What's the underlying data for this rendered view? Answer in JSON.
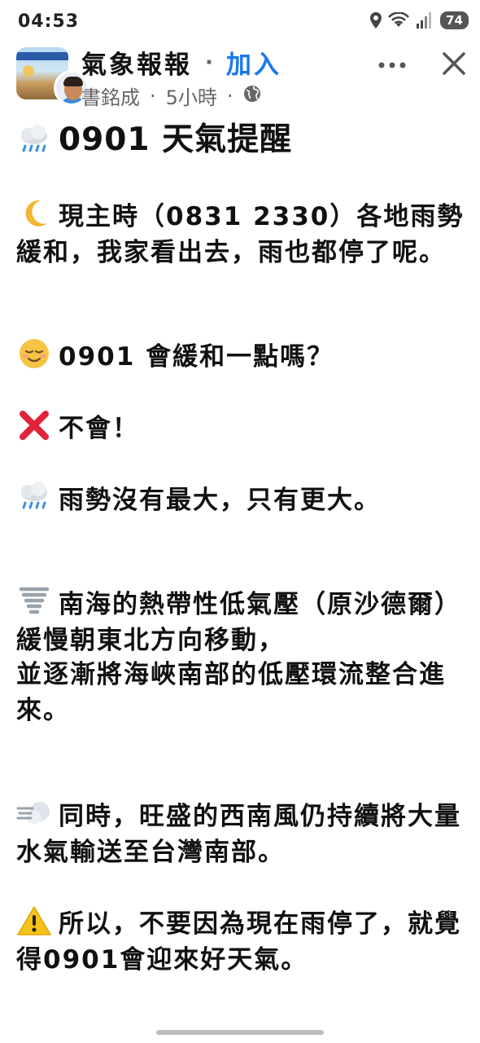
{
  "status_bar": {
    "time": "04:53",
    "battery": "74",
    "icons": [
      "location-icon",
      "wifi-icon",
      "signal-icon",
      "battery-icon"
    ]
  },
  "post": {
    "group_name": "氣象報報",
    "separator": "·",
    "join_label": "加入",
    "author": "書銘成",
    "time_ago": "5小時",
    "privacy_icon": "globe-icon",
    "title": "0901 天氣提醒",
    "paragraphs": [
      {
        "icon": "cloud-rain-icon",
        "text": ""
      },
      {
        "icon": "crescent-moon-icon",
        "text": "現主時（0831 2330）各地雨勢緩和，我家看出去，雨也都停了呢。"
      },
      {
        "icon": "relieved-face-icon",
        "text": "0901 會緩和一點嗎？"
      },
      {
        "icon": "red-x-icon",
        "text": "不會！"
      },
      {
        "icon": "cloud-rain-icon",
        "text": "雨勢沒有最大，只有更大。"
      },
      {
        "icon": "tornado-icon",
        "text": "南海的熱帶性低氣壓（原沙德爾）緩慢朝東北方向移動，"
      },
      {
        "icon": "",
        "text": "並逐漸將海峽南部的低壓環流整合進來。"
      },
      {
        "icon": "wind-icon",
        "text": "同時，旺盛的西南風仍持續將大量水氣輸送至台灣南部。"
      },
      {
        "icon": "warning-icon",
        "text": "所以，不要因為現在雨停了，就覺得0901會迎來好天氣。"
      }
    ]
  },
  "colors": {
    "join": "#1877f2",
    "meta": "#666666",
    "text": "#111111"
  }
}
